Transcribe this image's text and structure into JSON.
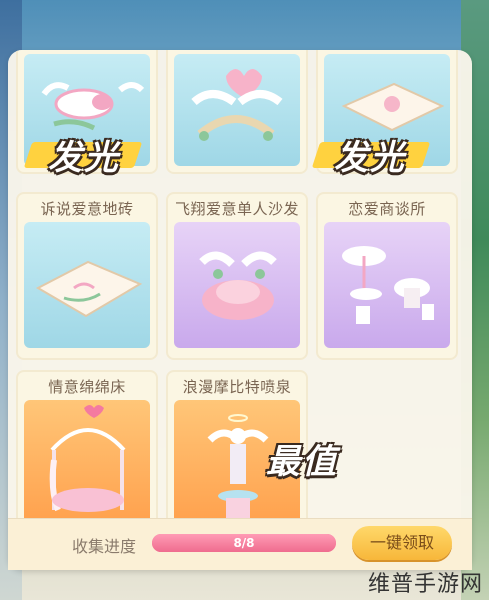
{
  "cards": [
    {
      "title": "",
      "badge": "发光",
      "bg": "blue"
    },
    {
      "title": "",
      "badge": "",
      "bg": "blue"
    },
    {
      "title": "",
      "badge": "发光",
      "bg": "blue"
    },
    {
      "title": "诉说爱意地砖",
      "badge": "",
      "bg": "blue"
    },
    {
      "title": "飞翔爱意单人沙发",
      "badge": "",
      "bg": "purple"
    },
    {
      "title": "恋爱商谈所",
      "badge": "",
      "bg": "purple"
    },
    {
      "title": "情意绵绵床",
      "badge": "",
      "bg": "orange"
    },
    {
      "title": "浪漫摩比特喷泉",
      "badge": "最值",
      "bg": "orange"
    }
  ],
  "progress": {
    "label": "收集进度",
    "text": "8/8",
    "fraction": 1.0
  },
  "claim_button": "一键领取",
  "watermark": "维普手游网",
  "colors": {
    "accent_pink": "#ef6c8e",
    "button_yellow": "#f7b73a",
    "badge_yellow": "#ffd23f"
  }
}
